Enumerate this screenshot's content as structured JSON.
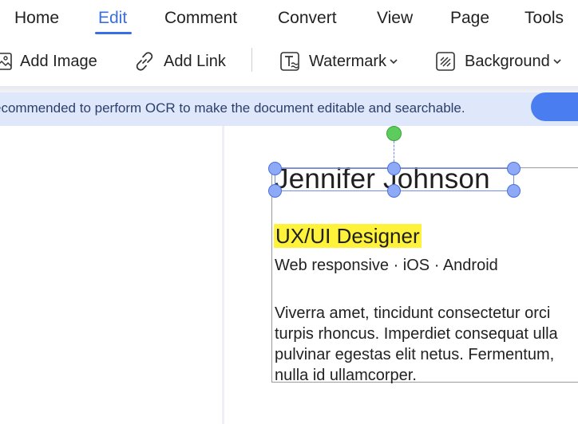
{
  "tabs": [
    {
      "label": "Home",
      "active": false
    },
    {
      "label": "Edit",
      "active": true
    },
    {
      "label": "Comment",
      "active": false
    },
    {
      "label": "Convert",
      "active": false
    },
    {
      "label": "View",
      "active": false
    },
    {
      "label": "Page",
      "active": false
    },
    {
      "label": "Tools",
      "active": false
    }
  ],
  "toolbar": {
    "add_image_label": "Add Image",
    "add_link_label": "Add Link",
    "watermark_label": "Watermark",
    "background_label": "Background"
  },
  "banner": {
    "text": "ecommended to perform OCR to make the document editable and searchable."
  },
  "document": {
    "name": "Jennifer Johnson",
    "role": "UX/UI Designer",
    "platforms": "Web responsive · iOS · Android",
    "body_lines": [
      "Viverra amet, tincidunt consectetur orci",
      "turpis rhoncus. Imperdiet consequat ulla",
      "pulvinar egestas elit netus. Fermentum,",
      "nulla id ullamcorper."
    ]
  },
  "colors": {
    "accent": "#3a6ee8",
    "banner_bg": "#dfe7fb",
    "highlight": "#fff23a",
    "selection_handle": "#8ea9f5",
    "rotate_handle": "#5ccc5c"
  }
}
